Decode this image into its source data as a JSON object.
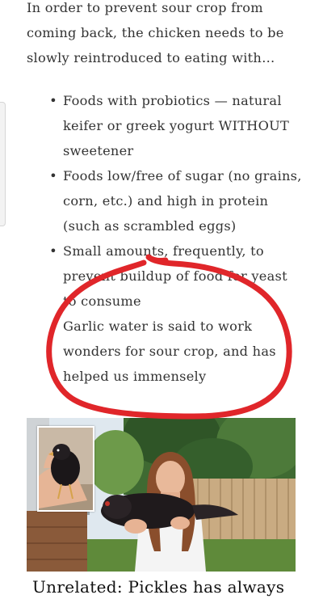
{
  "article": {
    "intro": "In order to prevent sour crop from coming back, the chicken needs to be slowly reintroduced to eating with…",
    "bullets": [
      {
        "text": "Foods with probiotics — natural keifer or greek yogurt WITHOUT sweetener"
      },
      {
        "text": "Foods low/free of sugar (no grains, corn, etc.) and high in protein (such as scrambled eggs)"
      },
      {
        "text": "Small amounts, frequently, to prevent buildup of food for yeast to consume"
      },
      {
        "text": "Garlic water is said to work wonders for sour crop, and has helped us immensely"
      }
    ],
    "bullet_glyph": "•",
    "caption": "Unrelated: Pickles has always"
  },
  "colors": {
    "text": "#333333",
    "annotation_circle": "#e0262a",
    "background": "#ffffff"
  },
  "images": {
    "main_photo": "woman-holding-black-chicken-in-backyard",
    "inset_photo": "hand-holding-black-chick"
  }
}
